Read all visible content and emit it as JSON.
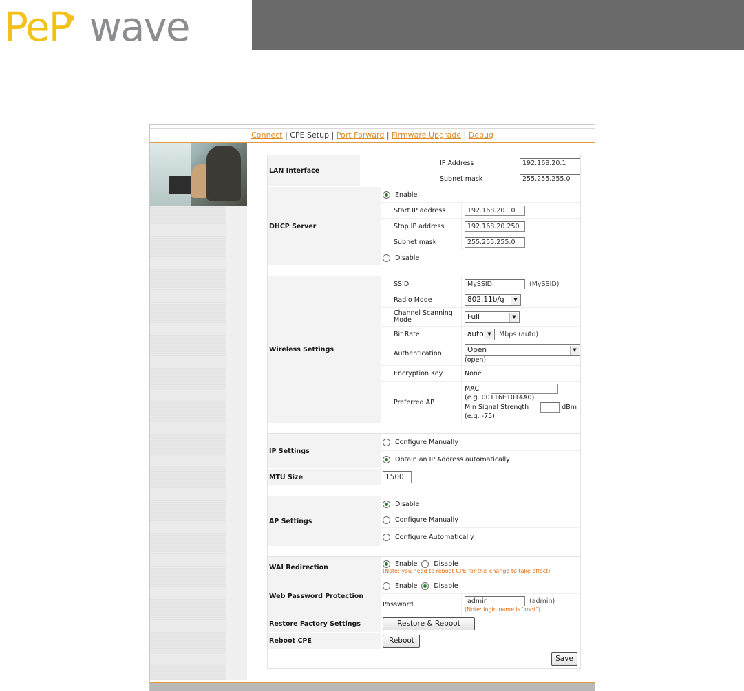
{
  "brand": {
    "part1": "PeP",
    "part2": "wave"
  },
  "nav": {
    "connect": "Connect",
    "cpe_setup": "CPE Setup",
    "port_forward": "Port Forward",
    "firmware_upgrade": "Firmware Upgrade",
    "debug": "Debug",
    "separator": "|"
  },
  "lan": {
    "label": "LAN Interface",
    "ip_label": "IP Address",
    "ip_value": "192.168.20.1",
    "mask_label": "Subnet mask",
    "mask_value": "255.255.255.0"
  },
  "dhcp": {
    "label": "DHCP Server",
    "enable": "Enable",
    "start_label": "Start IP address",
    "start_value": "192.168.20.10",
    "stop_label": "Stop IP address",
    "stop_value": "192.168.20.250",
    "mask_label": "Subnet mask",
    "mask_value": "255.255.255.0",
    "disable": "Disable",
    "selected": "Enable"
  },
  "wireless": {
    "label": "Wireless Settings",
    "ssid_label": "SSID",
    "ssid_value": "MySSID",
    "ssid_hint": "(MySSID)",
    "radio_label": "Radio Mode",
    "radio_value": "802.11b/g",
    "scan_label": "Channel Scanning Mode",
    "scan_value": "Full",
    "bitrate_label": "Bit Rate",
    "bitrate_value": "auto",
    "bitrate_hint": "Mbps (auto)",
    "auth_label": "Authentication",
    "auth_value": "Open",
    "auth_hint": "(open)",
    "enc_label": "Encryption Key",
    "enc_value": "None",
    "pref_label": "Preferred AP",
    "mac_label": "MAC",
    "mac_value": "",
    "mac_hint": "(e.g. 00116E1014A0)",
    "signal_label": "Min Signal Strength",
    "signal_value": "",
    "signal_unit": "dBm",
    "signal_hint": "(e.g. -75)"
  },
  "ip_settings": {
    "label": "IP Settings",
    "manual": "Configure Manually",
    "auto": "Obtain an IP Address automatically",
    "selected": "auto"
  },
  "mtu": {
    "label": "MTU Size",
    "value": "1500"
  },
  "ap": {
    "label": "AP Settings",
    "disable": "Disable",
    "manual": "Configure Manually",
    "auto": "Configure Automatically",
    "selected": "Disable"
  },
  "wai": {
    "label": "WAI Redirection",
    "enable": "Enable",
    "disable": "Disable",
    "note": "(Note: you need to reboot CPE for this change to take effect)",
    "selected": "Enable"
  },
  "webpass": {
    "label": "Web Password Protection",
    "enable": "Enable",
    "disable": "Disable",
    "selected": "Disable",
    "pw_label": "Password",
    "pw_value": "admin",
    "pw_hint": "(admin)",
    "note": "(Note: login name is \"root\")"
  },
  "restore": {
    "label": "Restore Factory Settings",
    "button": "Restore & Reboot"
  },
  "reboot": {
    "label": "Reboot CPE",
    "button": "Reboot"
  },
  "save_button": "Save",
  "colors": {
    "accent": "#e08a1e",
    "brand_yellow": "#f2c21b",
    "brand_gray": "#8c8d8f",
    "topbar": "#6a6a6a",
    "note": "#e06a10"
  }
}
